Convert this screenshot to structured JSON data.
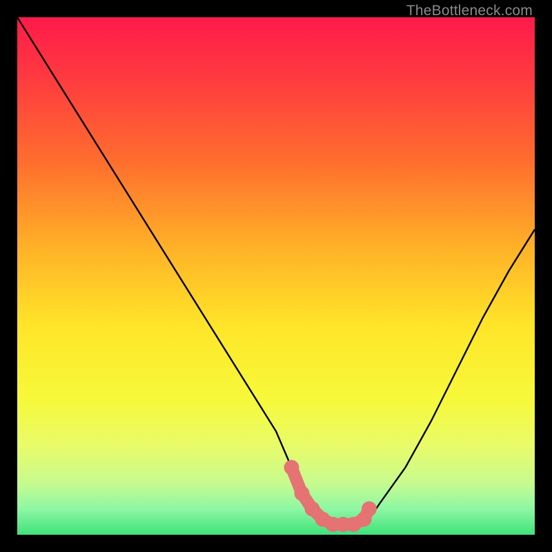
{
  "watermark": "TheBottleneck.com",
  "colors": {
    "black": "#000000",
    "curve": "#000000",
    "marker": "#e57373",
    "gradient_stops": [
      {
        "offset": 0.0,
        "color": "#ff1a4b"
      },
      {
        "offset": 0.12,
        "color": "#ff3b3f"
      },
      {
        "offset": 0.28,
        "color": "#ff6e2e"
      },
      {
        "offset": 0.45,
        "color": "#ffb327"
      },
      {
        "offset": 0.6,
        "color": "#ffe629"
      },
      {
        "offset": 0.74,
        "color": "#f6f93a"
      },
      {
        "offset": 0.83,
        "color": "#e8fb6a"
      },
      {
        "offset": 0.9,
        "color": "#c7fb8e"
      },
      {
        "offset": 0.95,
        "color": "#8ef7a4"
      },
      {
        "offset": 1.0,
        "color": "#3fe27a"
      }
    ]
  },
  "chart_data": {
    "type": "line",
    "title": "",
    "xlabel": "",
    "ylabel": "",
    "xlim": [
      0,
      100
    ],
    "ylim": [
      0,
      100
    ],
    "series": [
      {
        "name": "bottleneck_curve",
        "x": [
          0,
          5,
          10,
          15,
          20,
          25,
          30,
          35,
          40,
          45,
          50,
          53,
          55,
          58,
          62,
          66,
          68,
          70,
          75,
          80,
          85,
          90,
          95,
          100
        ],
        "y": [
          100,
          92,
          84,
          76,
          68,
          60,
          52,
          44,
          36,
          28,
          20,
          13,
          8,
          4,
          2,
          2,
          3,
          6,
          13,
          22,
          32,
          42,
          51,
          59
        ]
      }
    ],
    "markers": {
      "name": "highlight_minimum",
      "x": [
        53,
        55,
        57,
        59,
        61,
        63,
        65,
        67,
        68
      ],
      "y": [
        13,
        8,
        5,
        3,
        2,
        2,
        2,
        3,
        5
      ]
    }
  }
}
